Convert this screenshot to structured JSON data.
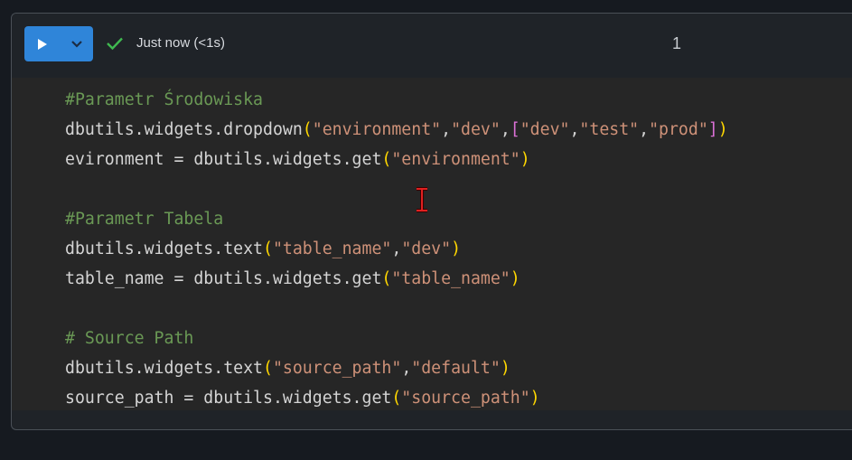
{
  "cell": {
    "status_text": "Just now (<1s)",
    "number": "1",
    "colors": {
      "run_button": "#2f85d9",
      "success_check": "#3fb950",
      "comment": "#6a9955",
      "string": "#ce9178",
      "bracket_level1": "#ffd700",
      "bracket_level2": "#da70d6"
    }
  },
  "icons": {
    "run": "play-icon",
    "dropdown": "chevron-down-icon",
    "status": "check-icon",
    "cursor": "text-cursor-icon"
  },
  "code": {
    "lines": [
      {
        "tokens": [
          {
            "t": "comment",
            "v": "#Parametr Środowiska"
          }
        ]
      },
      {
        "tokens": [
          {
            "t": "plain",
            "v": "dbutils.widgets.dropdown"
          },
          {
            "t": "br1",
            "v": "("
          },
          {
            "t": "str",
            "v": "\"environment\""
          },
          {
            "t": "plain",
            "v": ","
          },
          {
            "t": "str",
            "v": "\"dev\""
          },
          {
            "t": "plain",
            "v": ","
          },
          {
            "t": "br2",
            "v": "["
          },
          {
            "t": "str",
            "v": "\"dev\""
          },
          {
            "t": "plain",
            "v": ","
          },
          {
            "t": "str",
            "v": "\"test\""
          },
          {
            "t": "plain",
            "v": ","
          },
          {
            "t": "str",
            "v": "\"prod\""
          },
          {
            "t": "br2",
            "v": "]"
          },
          {
            "t": "br1",
            "v": ")"
          }
        ]
      },
      {
        "tokens": [
          {
            "t": "plain",
            "v": "evironment = dbutils.widgets.get"
          },
          {
            "t": "br1",
            "v": "("
          },
          {
            "t": "str",
            "v": "\"environment\""
          },
          {
            "t": "br1",
            "v": ")"
          }
        ]
      },
      {
        "tokens": []
      },
      {
        "tokens": [
          {
            "t": "comment",
            "v": "#Parametr Tabela"
          }
        ]
      },
      {
        "tokens": [
          {
            "t": "plain",
            "v": "dbutils.widgets.text"
          },
          {
            "t": "br1",
            "v": "("
          },
          {
            "t": "str",
            "v": "\"table_name\""
          },
          {
            "t": "plain",
            "v": ","
          },
          {
            "t": "str",
            "v": "\"dev\""
          },
          {
            "t": "br1",
            "v": ")"
          }
        ]
      },
      {
        "tokens": [
          {
            "t": "plain",
            "v": "table_name = dbutils.widgets.get"
          },
          {
            "t": "br1",
            "v": "("
          },
          {
            "t": "str",
            "v": "\"table_name\""
          },
          {
            "t": "br1",
            "v": ")"
          }
        ]
      },
      {
        "tokens": []
      },
      {
        "tokens": [
          {
            "t": "comment",
            "v": "# Source Path"
          }
        ]
      },
      {
        "tokens": [
          {
            "t": "plain",
            "v": "dbutils.widgets.text"
          },
          {
            "t": "br1",
            "v": "("
          },
          {
            "t": "str",
            "v": "\"source_path\""
          },
          {
            "t": "plain",
            "v": ","
          },
          {
            "t": "str",
            "v": "\"default\""
          },
          {
            "t": "br1",
            "v": ")"
          }
        ]
      },
      {
        "tokens": [
          {
            "t": "plain",
            "v": "source_path = dbutils.widgets.get"
          },
          {
            "t": "br1",
            "v": "("
          },
          {
            "t": "str",
            "v": "\"source_path\""
          },
          {
            "t": "br1",
            "v": ")"
          }
        ]
      }
    ]
  }
}
